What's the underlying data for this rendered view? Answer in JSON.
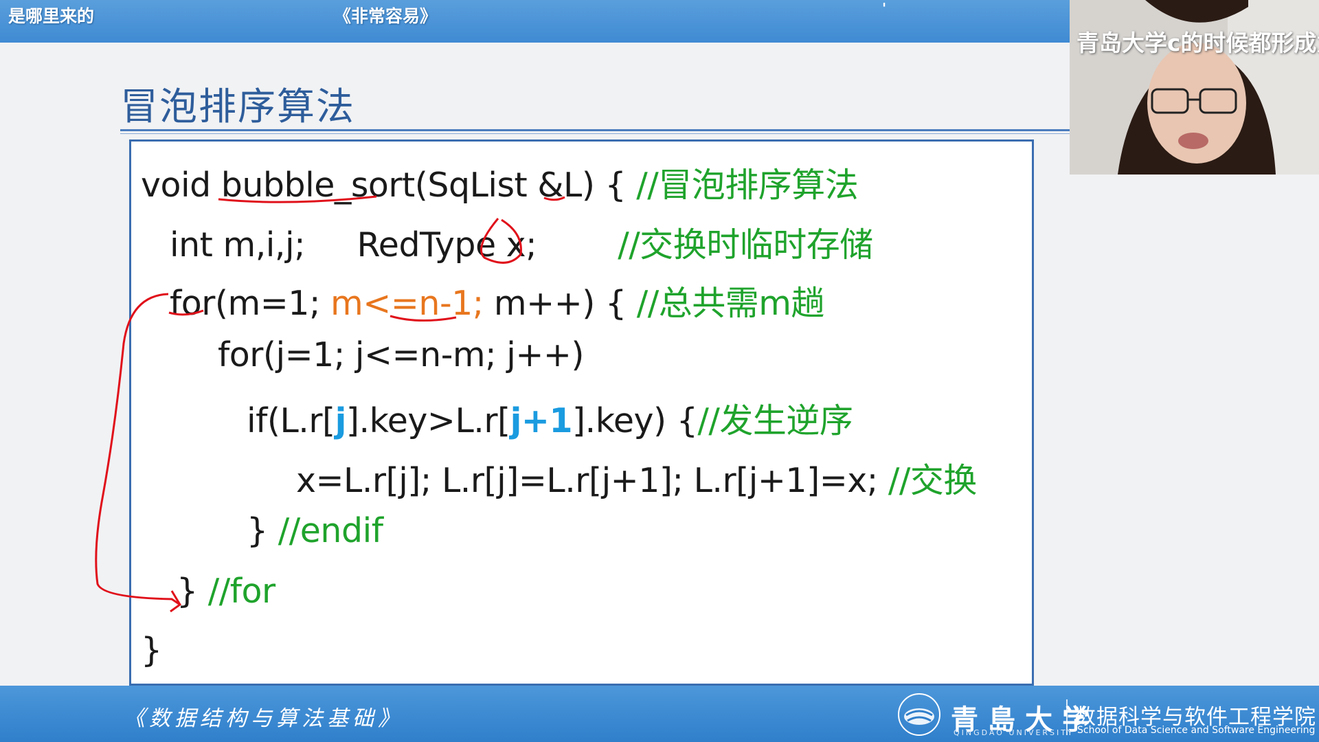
{
  "danmaku": {
    "left": "是哪里来的",
    "middle": "《非常容易》",
    "dot": "'",
    "webcam_overlay": "青岛大学c的时候都形成意"
  },
  "slide": {
    "title": "冒泡排序算法",
    "code_lines": [
      {
        "code": "void bubble_sort(SqList &L) { ",
        "comment": "//冒泡排序算法"
      },
      {
        "code": "int m,i,j;     RedType x;",
        "comment": "//交换时临时存储"
      },
      {
        "code_prefix": "for(m=1; ",
        "code_highlight": "m<=n-1;",
        "code_suffix": " m++) { ",
        "comment": "//总共需m趟"
      },
      {
        "code": "for(j=1; j<=n-m; j++)"
      },
      {
        "code_a": "if(L.r[",
        "hl_a": "j",
        "code_b": "].key>L.r[",
        "hl_b": "j+1",
        "code_c": "].key) {",
        "comment": "//发生逆序"
      },
      {
        "code": "x=L.r[j]; L.r[j]=L.r[j+1]; L.r[j+1]=x; ",
        "comment": "//交换"
      },
      {
        "code": "} ",
        "comment": "//endif"
      },
      {
        "code": "} ",
        "comment": "//for"
      },
      {
        "code": "}"
      }
    ]
  },
  "footer": {
    "course": "《数据结构与算法基础》",
    "university": "青島大学",
    "university_en": "QINGDAO UNIVERSITY",
    "school": "数据科学与软件工程学院",
    "school_en": "School of Data Science and Software Engineering"
  },
  "colors": {
    "comment": "#1fa32c",
    "highlight_orange": "#e8761e",
    "highlight_blue": "#1a9be0",
    "annotation_red": "#e0101a",
    "bar_blue": "#3f8ad3"
  }
}
